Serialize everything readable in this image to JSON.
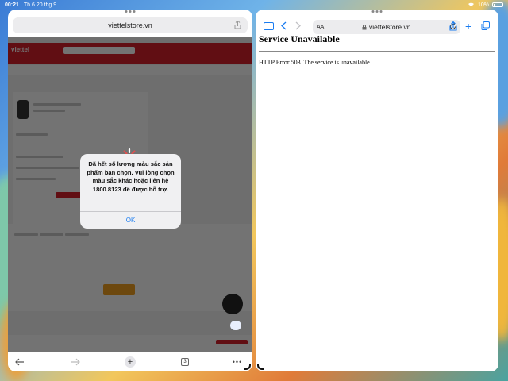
{
  "status_bar": {
    "time": "00:21",
    "date": "Th 6 20 thg 9",
    "battery": "10%"
  },
  "left_window": {
    "address": "viettelstore.vn",
    "site_logo": "viettel",
    "alert": {
      "message": "Đã hết số lượng màu sắc sản phẩm bạn chọn. Vui lòng chọn màu sắc khác hoặc liên hệ 1800.8123 để được hỗ trợ.",
      "ok_label": "OK"
    },
    "toolbar": {
      "tab_count": "3"
    }
  },
  "right_window": {
    "address": "viettelstore.vn",
    "aa_label": "AA",
    "error_title": "Service Unavailable",
    "error_body": "HTTP Error 503. The service is unavailable."
  }
}
